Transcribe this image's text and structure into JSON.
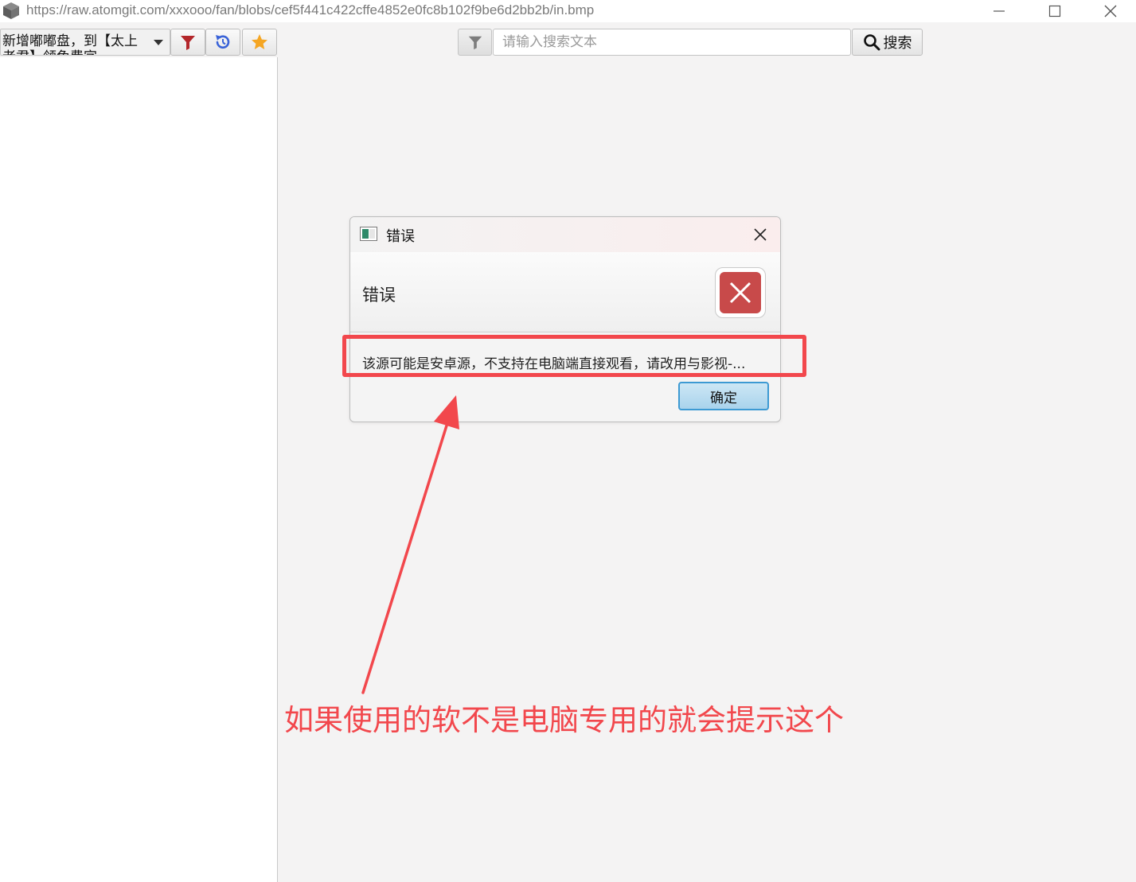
{
  "window": {
    "url": "https://raw.atomgit.com/xxxooo/fan/blobs/cef5f441c422cffe4852e0fc8b102f9be6d2bb2b/in.bmp",
    "controls": [
      "minimize-icon",
      "maximize-icon",
      "close-icon"
    ]
  },
  "toolbar": {
    "source_select_value": "新增嘟嘟盘，到【太上老君】领兔费字",
    "buttons": [
      {
        "icon": "filter-icon",
        "color": "#b3262a"
      },
      {
        "icon": "refresh-icon",
        "color": "#3a63d8"
      },
      {
        "icon": "star-icon",
        "color": "#f5a623"
      }
    ]
  },
  "search": {
    "filter_icon": "filter-icon",
    "placeholder": "请输入搜索文本",
    "button_label": "搜索",
    "button_icon": "search-icon"
  },
  "dialog": {
    "title": "错误",
    "header_text": "错误",
    "content": "该源可能是安卓源，不支持在电脑端直接观看，请改用与影视-...",
    "ok_label": "确定",
    "error_icon_color": "#c84a4a"
  },
  "annotation": {
    "text": "如果使用的软不是电脑专用的就会提示这个",
    "color": "#f2474c"
  }
}
